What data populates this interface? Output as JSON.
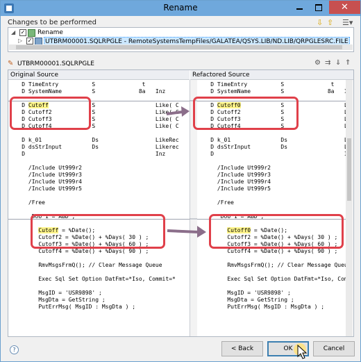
{
  "window": {
    "title": "Rename",
    "close_glyph": "✕"
  },
  "changes_header": "Changes to be performed",
  "tree": {
    "root_label": "Rename",
    "file_label": "UTBRM00001.SQLRPGLE - RemoteSystemsTempFiles/GALATEA/QSYS.LIB/ND.LIB/QRPGLESRC.FILE"
  },
  "file_header": "UTBRM00001.SQLRPGLE",
  "original_header": "Original Source",
  "refactored_header": "Refactored Source",
  "original_lines": [
    "    D TimeEntry          S              t",
    "    D SystemName         S             8a   Inz",
    "",
    "    D Cutoff             S                  Like( C",
    "    D Cutoff2            S                  Like( C",
    "    D Cutoff3            S                  Like( C",
    "    D Cutoff4            S                  Like( C",
    "",
    "    D k_01               Ds                 LikeRec",
    "    D dsStrInput         Ds                 Likerec",
    "    D                                       Inz",
    "",
    "      /Include Ut999r2",
    "      /Include Ut999r3",
    "      /Include Ut999r4",
    "      /Include Ut999r5",
    "",
    "      /Free",
    "",
    "       DoU 1 = ABD ;",
    "",
    "         Cutoff = %Date();",
    "         Cutoff2 = %Date() + %Days( 30 ) ;",
    "         Cutoff3 = %Date() + %Days( 60 ) ;",
    "         Cutoff4 = %Date() + %Days( 90 ) ;",
    "",
    "         RmvMsgsFrmQ(); // Clear Message Queue",
    "",
    "         Exec Sql Set Option DatFmt=*Iso, Commit=*",
    "",
    "         MsgID = 'USR9898' ;",
    "         MsgDta = GetString ;",
    "         PutErrMsg( MsgID : MsgDta ) ;"
  ],
  "refactored_lines": [
    "    D TimeEntry          S              t",
    "    D SystemName         S             8a   Inz",
    "",
    "    D Cutoff0            S                  Lik",
    "    D Cutoff2            S                  Lik",
    "    D Cutoff3            S                  Lik",
    "    D Cutoff4            S                  Lik",
    "",
    "    D k_01               Ds                 Lik",
    "    D dsStrInput         Ds                 Lik",
    "    D                                       Inz",
    "",
    "      /Include Ut999r2",
    "      /Include Ut999r3",
    "      /Include Ut999r4",
    "      /Include Ut999r5",
    "",
    "      /Free",
    "",
    "       DoU 1 = ABD ;",
    "",
    "         Cutoff0 = %Date();",
    "         Cutoff2 = %Date() + %Days( 30 ) ;",
    "         Cutoff3 = %Date() + %Days( 60 ) ;",
    "         Cutoff4 = %Date() + %Days( 90 ) ;",
    "",
    "         RmvMsgsFrmQ(); // Clear Message Queue",
    "",
    "         Exec Sql Set Option DatFmt=*Iso, Comm",
    "",
    "         MsgID = 'USR9898' ;",
    "         MsgDta = GetString ;",
    "         PutErrMsg( MsgID : MsgDta ) ;"
  ],
  "highlight_words": {
    "original": "Cutoff",
    "refactored": "Cutoff0"
  },
  "buttons": {
    "back": "< Back",
    "ok": "OK",
    "cancel": "Cancel"
  },
  "colors": {
    "annotation": "#e0404a",
    "arrow": "#8b6e8a",
    "highlight": "#fff58a",
    "title_bar": "#6fa8dc"
  },
  "icons": [
    "pencil-icon",
    "help-icon",
    "checkbox-icon",
    "file-icon",
    "arrow-up-icon",
    "arrow-down-icon",
    "filter-icon"
  ]
}
